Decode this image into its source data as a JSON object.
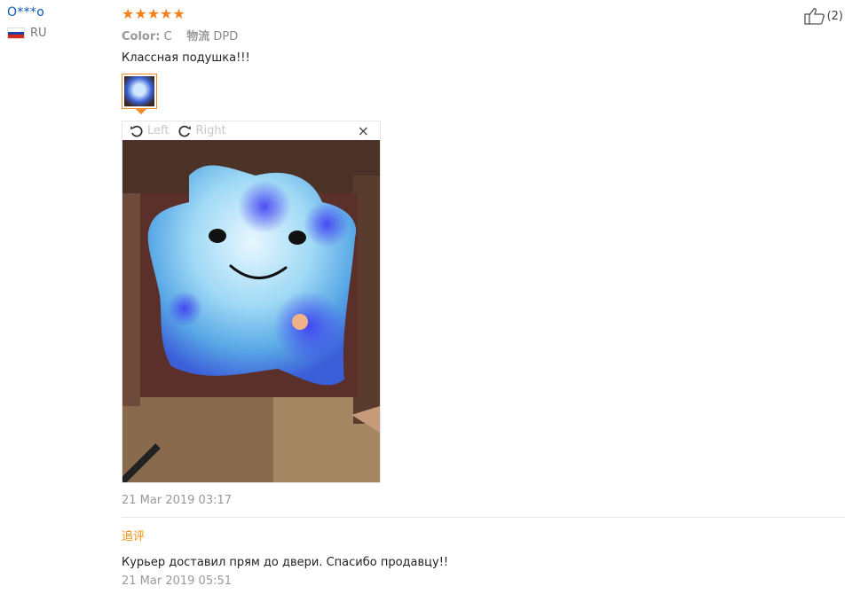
{
  "user": {
    "name": "O***o",
    "country": "RU"
  },
  "review": {
    "stars": "★★★★★",
    "rating": 5,
    "color_label": "Color:",
    "color_value": "C",
    "shipping_label": "物流",
    "shipping_value": "DPD",
    "text": "Классная подушка!!!",
    "date": "21 Mar 2019 03:17",
    "likes": "(2)"
  },
  "viewer": {
    "rotate_left_label": "Left",
    "rotate_right_label": "Right",
    "close_glyph": "×"
  },
  "followup": {
    "label": "追评",
    "text": "Курьер доставил прям до двери. Спасибо продавцу!!",
    "date": "21 Mar 2019 05:51"
  },
  "icons": [
    "flag-ru-icon",
    "star-icon",
    "rotate-left-icon",
    "rotate-right-icon",
    "close-icon",
    "thumbs-up-icon"
  ],
  "colors": {
    "accent": "#f5811e",
    "user_link": "#0c5ab0",
    "followup": "#f0900e"
  }
}
